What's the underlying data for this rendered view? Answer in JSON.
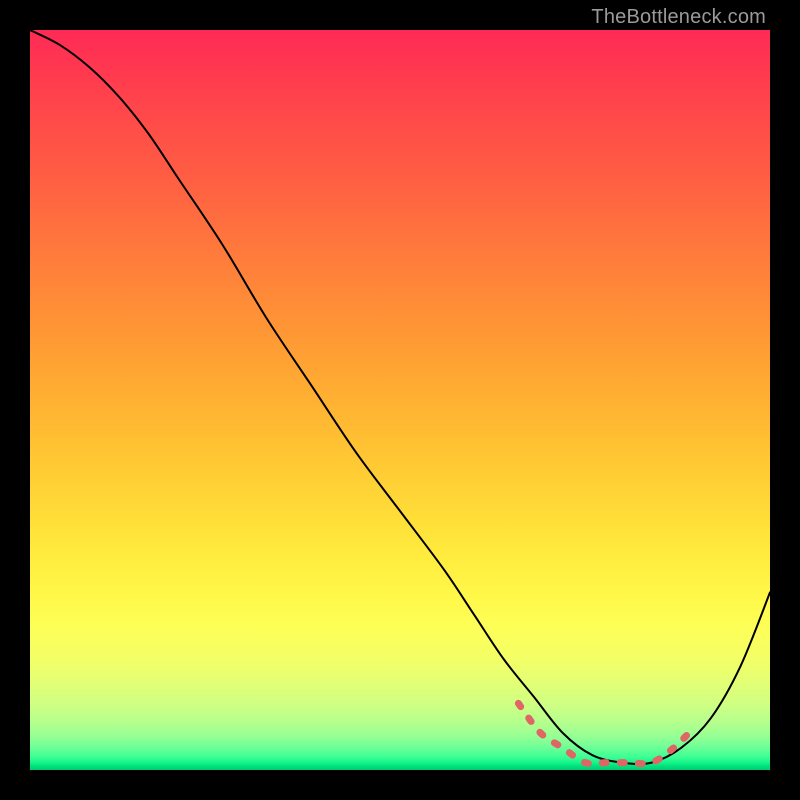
{
  "watermark": "TheBottleneck.com",
  "colors": {
    "curve_stroke": "#000000",
    "dashed_stroke": "#e06666",
    "background": "#000000"
  },
  "chart_data": {
    "type": "line",
    "title": "",
    "xlabel": "",
    "ylabel": "",
    "xlim": [
      0,
      100
    ],
    "ylim": [
      0,
      100
    ],
    "grid": false,
    "legend": false,
    "note": "Axes have no tick labels in the image; values are estimated in 0–100 percent of plot width/height. A single black curve descends from top-left, reaches a flat minimum near x≈70–82, then rises toward the right edge. A red dashed overlay highlights the minimum region.",
    "series": [
      {
        "name": "curve",
        "x": [
          0,
          4,
          8,
          12,
          16,
          20,
          26,
          32,
          38,
          44,
          50,
          56,
          60,
          64,
          68,
          72,
          76,
          80,
          84,
          88,
          92,
          96,
          100
        ],
        "y": [
          100,
          98,
          95,
          91,
          86,
          80,
          71,
          61,
          52,
          43,
          35,
          27,
          21,
          15,
          10,
          5,
          2,
          1,
          1,
          3,
          7,
          14,
          24
        ]
      },
      {
        "name": "minimum_highlight_dashed",
        "x": [
          66,
          69,
          72,
          75,
          78,
          81,
          84,
          87,
          90
        ],
        "y": [
          9,
          5,
          3,
          1,
          1,
          1,
          1,
          3,
          6
        ]
      }
    ]
  }
}
